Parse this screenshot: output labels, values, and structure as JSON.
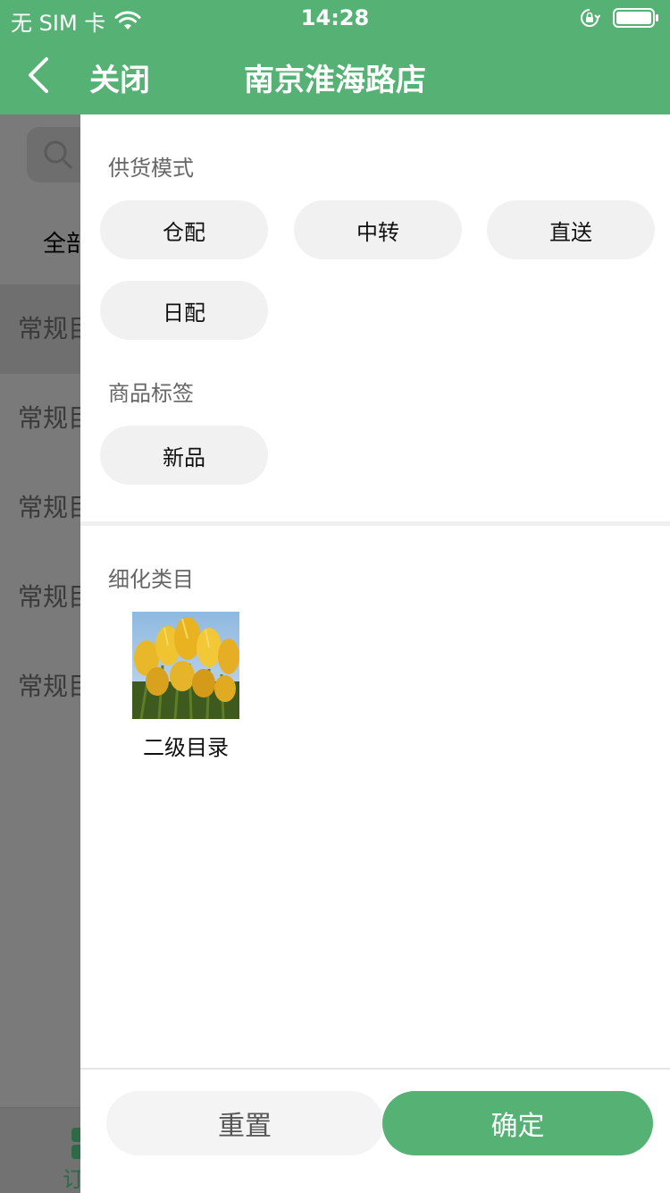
{
  "status_bar": {
    "carrier": "无 SIM 卡",
    "time": "14:28"
  },
  "nav": {
    "close_label": "关闭",
    "title": "南京淮海路店"
  },
  "background": {
    "tab_label": "全部",
    "list_items": [
      "常规目",
      "常规目",
      "常规目",
      "常规目",
      "常规目"
    ],
    "footer_label": "订"
  },
  "filter": {
    "supply_mode": {
      "title": "供货模式",
      "options": [
        "仓配",
        "中转",
        "直送",
        "日配"
      ]
    },
    "product_tag": {
      "title": "商品标签",
      "options": [
        "新品"
      ]
    },
    "sub_category": {
      "title": "细化类目",
      "items": [
        {
          "label": "二级目录"
        }
      ]
    },
    "reset_label": "重置",
    "confirm_label": "确定"
  },
  "colors": {
    "brand_green": "#56b274",
    "chip_bg": "#f1f1f1",
    "overlay_gray": "#7a7a7a"
  },
  "icons": [
    "back-icon",
    "wifi-icon",
    "rotation-lock-icon",
    "battery-icon",
    "search-icon"
  ]
}
